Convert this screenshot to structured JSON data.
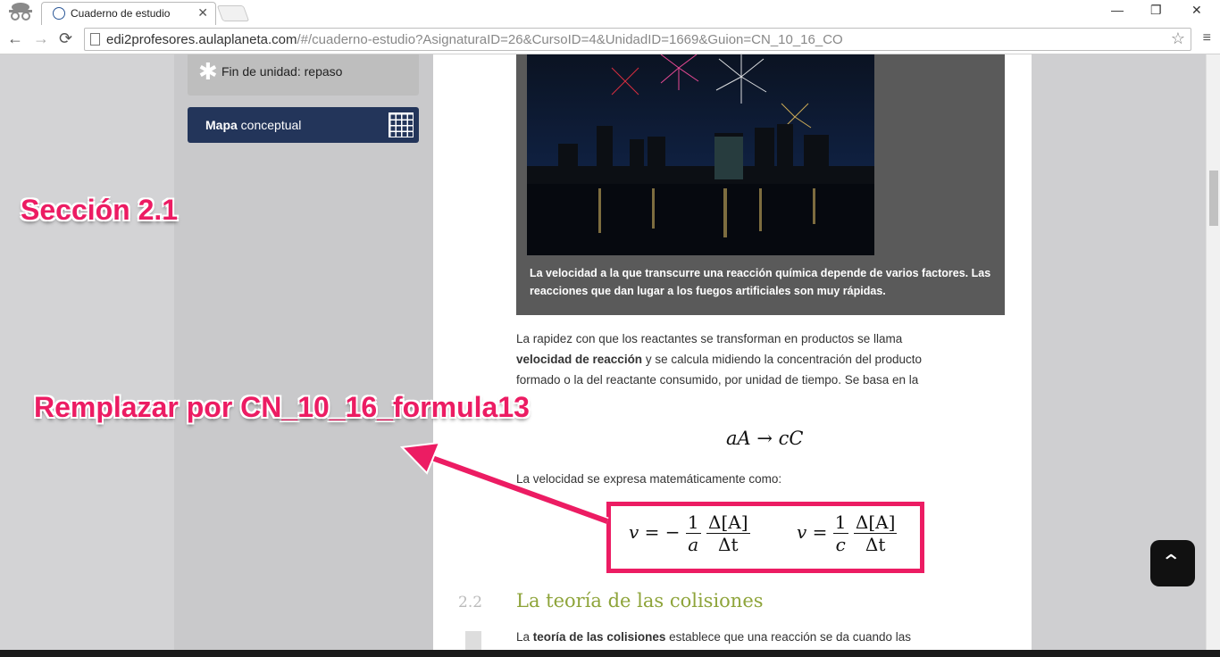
{
  "browser": {
    "tab_title": "Cuaderno de estudio",
    "tab_close": "✕",
    "url_host": "edi2profesores.aulaplaneta.com",
    "url_path": "/#/cuaderno-estudio?AsignaturaID=26&CursoID=4&UnidadID=1669&Guion=CN_10_16_CO",
    "minimize": "—",
    "maximize": "❐",
    "close": "✕"
  },
  "sidebar": {
    "repaso_label": "Fin de unidad: repaso",
    "mapa_bold": "Mapa",
    "mapa_rest": " conceptual"
  },
  "content": {
    "caption": "La velocidad a la que transcurre una reacción química depende de varios factores. Las reacciones que dan lugar a los fuegos artificiales son muy rápidas.",
    "para1_a": "La rapidez con que los reactantes se transforman en productos se llama ",
    "para1_b": "velocidad de reacción",
    "para1_c": " y se calcula midiendo la concentración del producto formado o la del reactante consumido, por unidad de tiempo. Se basa en la",
    "formula1": "aA → cC",
    "para2": "La velocidad se expresa matemáticamente como:",
    "eq1": {
      "v": "v",
      "eq": " = −",
      "num1": "1",
      "den1": "a",
      "num2": "Δ[A]",
      "den2": "Δt"
    },
    "eq2": {
      "v": "v",
      "eq": " = ",
      "num1": "1",
      "den1": "c",
      "num2": "Δ[A]",
      "den2": "Δt"
    },
    "section_num": "2.2",
    "section_title": "La teoría de las colisiones",
    "para3_a": "La ",
    "para3_b": "teoría de las colisiones",
    "para3_c": " establece que una reacción se da cuando las"
  },
  "annotations": {
    "section_label": "Sección 2.1",
    "replace_label": "Remplazar por CN_10_16_formula13",
    "color": "#ec1c63"
  },
  "up_button": "⌃"
}
